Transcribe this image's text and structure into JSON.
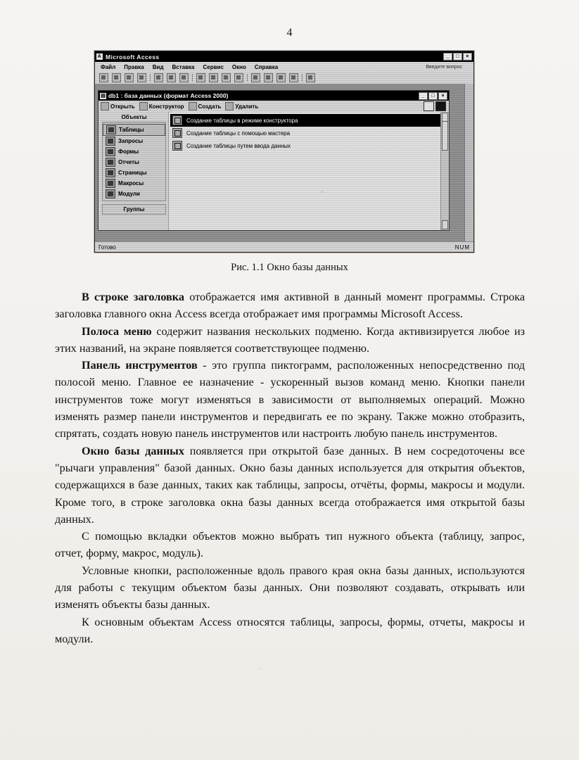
{
  "page": {
    "number": "4"
  },
  "figure": {
    "caption": "Рис. 1.1 Окно базы данных",
    "app_window": {
      "title": "Microsoft Access",
      "icon": "access-icon",
      "menu": [
        "Файл",
        "Правка",
        "Вид",
        "Вставка",
        "Сервис",
        "Окно",
        "Справка"
      ],
      "ask_box": "Введите вопрос",
      "window_buttons": [
        "_",
        "□",
        "×"
      ]
    },
    "db_window": {
      "title": "db1 : база данных (формат Access 2000)",
      "window_buttons": [
        "_",
        "□",
        "×"
      ],
      "toolbar": [
        "Открыть",
        "Конструктор",
        "Создать"
      ],
      "toolbar_extra": "Удалить",
      "objects_header": "Объекты",
      "objects": [
        "Таблицы",
        "Запросы",
        "Формы",
        "Отчеты",
        "Страницы",
        "Макросы",
        "Модули"
      ],
      "groups_label": "Группы",
      "items": [
        "Создание таблицы в режиме конструктора",
        "Создание таблицы с помощью мастера",
        "Создание таблицы путем ввода данных"
      ],
      "selected_item_index": 0
    },
    "statusbar": {
      "left": "Готово",
      "right": "NUM"
    }
  },
  "text": {
    "p1_lead": "В строке заголовка",
    "p1": " отображается имя активной в данный момент программы. Строка заголовка главного окна Access всегда отображает имя  программы Microsoft Access.",
    "p2_lead": "Полоса меню",
    "p2": " содержит названия нескольких подменю. Когда активизируется     любое  из  этих  названий,  на  экране  появляется соответствующее подменю.",
    "p3_lead": "Панель инструментов",
    "p3": " - это группа пиктограмм, расположенных непосредственно  под полосой меню. Главное ее назначение - ускоренный вызов команд меню.  Кнопки панели инструментов тоже могут изменяться в зависимости от выполняемых операций. Можно изменять размер панели инструментов и передвигать ее по экрану. Также можно отобразить, спрятать, создать новую панель инструментов  или настроить любую панель инструментов.",
    "p4_lead": "Окно базы данных",
    "p4": " появляется при открытой базе данных. В нем сосредоточены все \"рычаги управления\" базой данных. Окно базы данных используется для открытия объектов, содержащихся в базе данных, таких как таблицы, запросы, отчёты, формы, макросы и модули. Кроме того, в строке заголовка окна базы данных   всегда отображается имя открытой базы данных.",
    "p5": "С помощью вкладки объектов можно выбрать тип нужного объекта (таблицу, запрос, отчет, форму, макрос, модуль).",
    "p6": "Условные кнопки, расположенные вдоль правого края окна базы данных, используются для работы с текущим объектом базы данных. Они позволяют создавать, открывать или изменять объекты базы данных.",
    "p7": "К основным объектам Access относятся таблицы, запросы, формы, отчеты, макросы и модули."
  }
}
